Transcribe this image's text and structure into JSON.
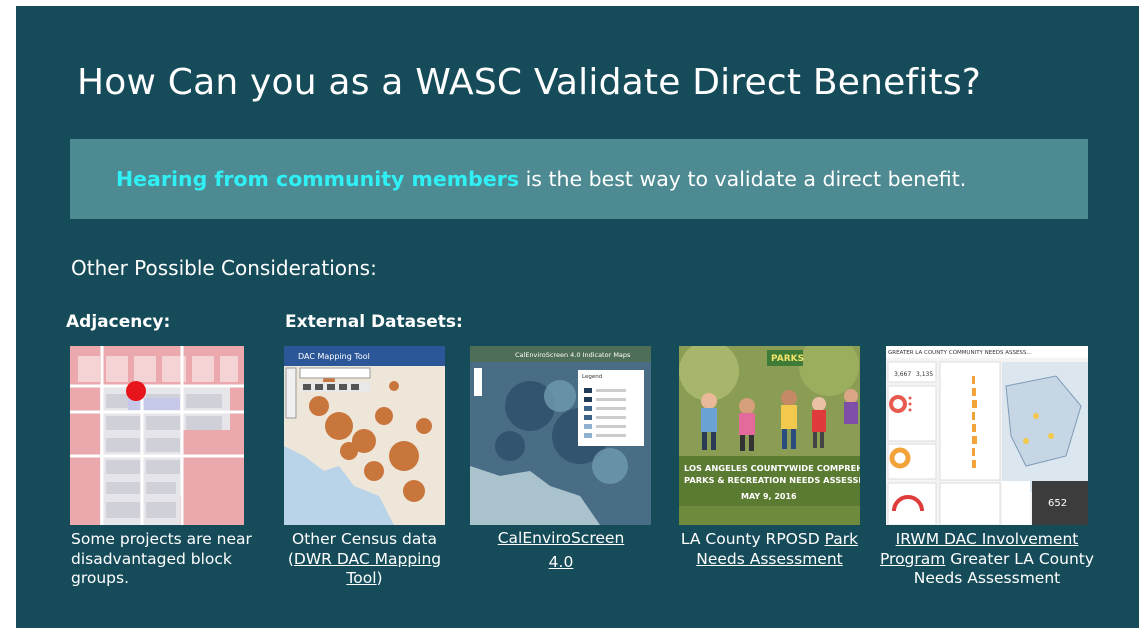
{
  "slide": {
    "title": "How Can you as a WASC Validate Direct Benefits?",
    "callout": {
      "highlight": "Hearing from community members",
      "rest": " is the best way to validate a direct benefit."
    },
    "subheading": "Other Possible Considerations:",
    "adjacency_label": "Adjacency:",
    "external_label": "External Datasets:",
    "adjacency_caption": "Some projects are near disadvantaged block groups.",
    "captions": {
      "census_text": "Other Census data (",
      "census_link": "DWR DAC Mapping Tool",
      "census_end": ")",
      "calenviro_link": "CalEnviroScreen 4.0",
      "rposd_text": "LA County RPOSD ",
      "rposd_link": "Park Needs Assessment",
      "irwm_link": "IRWM DAC Involvement Program",
      "irwm_text": " Greater LA County Needs Assessment"
    },
    "thumbs": {
      "dac_header": "DAC Mapping Tool",
      "calenviro_header": "CalEnviroScreen 4.0 Indicator Maps",
      "calenviro_legend_title": "Legend",
      "park_banner_top": "PARKS",
      "park_banner_line1": "LOS ANGELES COUNTYWIDE COMPREHE",
      "park_banner_line2": "PARKS & RECREATION NEEDS ASSESSI",
      "park_date": "MAY 9, 2016",
      "irwm_header": "GREATER LA COUNTY COMMUNITY NEEDS ASSESS...",
      "irwm_stat1": "3,667",
      "irwm_stat2": "3,135",
      "irwm_big": "652"
    },
    "colors": {
      "background": "#164c5a",
      "callout": "#4e8a92",
      "highlight": "#2ff0f5",
      "marker": "#e8141b"
    }
  }
}
